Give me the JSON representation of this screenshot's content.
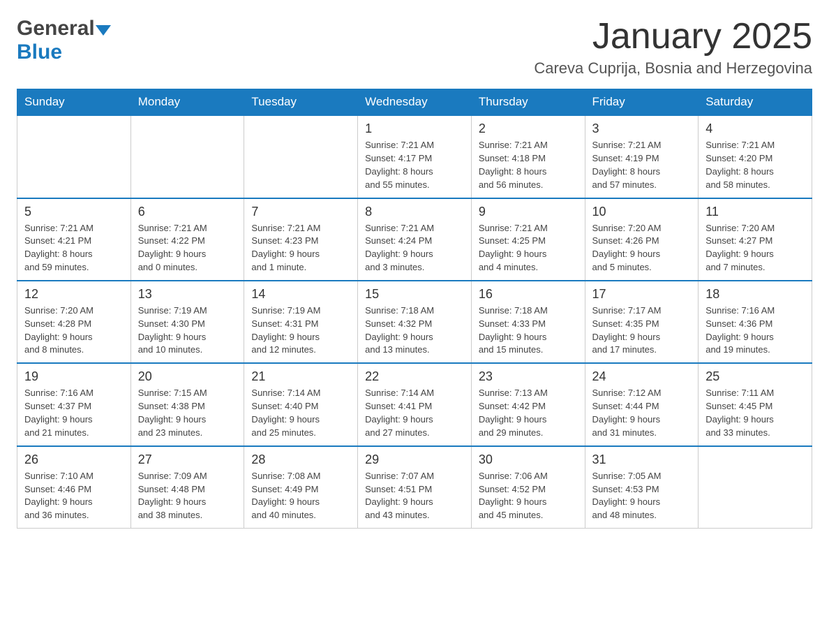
{
  "logo": {
    "general": "General",
    "blue": "Blue"
  },
  "header": {
    "month": "January 2025",
    "location": "Careva Cuprija, Bosnia and Herzegovina"
  },
  "days_of_week": [
    "Sunday",
    "Monday",
    "Tuesday",
    "Wednesday",
    "Thursday",
    "Friday",
    "Saturday"
  ],
  "weeks": [
    [
      {
        "day": "",
        "info": ""
      },
      {
        "day": "",
        "info": ""
      },
      {
        "day": "",
        "info": ""
      },
      {
        "day": "1",
        "info": "Sunrise: 7:21 AM\nSunset: 4:17 PM\nDaylight: 8 hours\nand 55 minutes."
      },
      {
        "day": "2",
        "info": "Sunrise: 7:21 AM\nSunset: 4:18 PM\nDaylight: 8 hours\nand 56 minutes."
      },
      {
        "day": "3",
        "info": "Sunrise: 7:21 AM\nSunset: 4:19 PM\nDaylight: 8 hours\nand 57 minutes."
      },
      {
        "day": "4",
        "info": "Sunrise: 7:21 AM\nSunset: 4:20 PM\nDaylight: 8 hours\nand 58 minutes."
      }
    ],
    [
      {
        "day": "5",
        "info": "Sunrise: 7:21 AM\nSunset: 4:21 PM\nDaylight: 8 hours\nand 59 minutes."
      },
      {
        "day": "6",
        "info": "Sunrise: 7:21 AM\nSunset: 4:22 PM\nDaylight: 9 hours\nand 0 minutes."
      },
      {
        "day": "7",
        "info": "Sunrise: 7:21 AM\nSunset: 4:23 PM\nDaylight: 9 hours\nand 1 minute."
      },
      {
        "day": "8",
        "info": "Sunrise: 7:21 AM\nSunset: 4:24 PM\nDaylight: 9 hours\nand 3 minutes."
      },
      {
        "day": "9",
        "info": "Sunrise: 7:21 AM\nSunset: 4:25 PM\nDaylight: 9 hours\nand 4 minutes."
      },
      {
        "day": "10",
        "info": "Sunrise: 7:20 AM\nSunset: 4:26 PM\nDaylight: 9 hours\nand 5 minutes."
      },
      {
        "day": "11",
        "info": "Sunrise: 7:20 AM\nSunset: 4:27 PM\nDaylight: 9 hours\nand 7 minutes."
      }
    ],
    [
      {
        "day": "12",
        "info": "Sunrise: 7:20 AM\nSunset: 4:28 PM\nDaylight: 9 hours\nand 8 minutes."
      },
      {
        "day": "13",
        "info": "Sunrise: 7:19 AM\nSunset: 4:30 PM\nDaylight: 9 hours\nand 10 minutes."
      },
      {
        "day": "14",
        "info": "Sunrise: 7:19 AM\nSunset: 4:31 PM\nDaylight: 9 hours\nand 12 minutes."
      },
      {
        "day": "15",
        "info": "Sunrise: 7:18 AM\nSunset: 4:32 PM\nDaylight: 9 hours\nand 13 minutes."
      },
      {
        "day": "16",
        "info": "Sunrise: 7:18 AM\nSunset: 4:33 PM\nDaylight: 9 hours\nand 15 minutes."
      },
      {
        "day": "17",
        "info": "Sunrise: 7:17 AM\nSunset: 4:35 PM\nDaylight: 9 hours\nand 17 minutes."
      },
      {
        "day": "18",
        "info": "Sunrise: 7:16 AM\nSunset: 4:36 PM\nDaylight: 9 hours\nand 19 minutes."
      }
    ],
    [
      {
        "day": "19",
        "info": "Sunrise: 7:16 AM\nSunset: 4:37 PM\nDaylight: 9 hours\nand 21 minutes."
      },
      {
        "day": "20",
        "info": "Sunrise: 7:15 AM\nSunset: 4:38 PM\nDaylight: 9 hours\nand 23 minutes."
      },
      {
        "day": "21",
        "info": "Sunrise: 7:14 AM\nSunset: 4:40 PM\nDaylight: 9 hours\nand 25 minutes."
      },
      {
        "day": "22",
        "info": "Sunrise: 7:14 AM\nSunset: 4:41 PM\nDaylight: 9 hours\nand 27 minutes."
      },
      {
        "day": "23",
        "info": "Sunrise: 7:13 AM\nSunset: 4:42 PM\nDaylight: 9 hours\nand 29 minutes."
      },
      {
        "day": "24",
        "info": "Sunrise: 7:12 AM\nSunset: 4:44 PM\nDaylight: 9 hours\nand 31 minutes."
      },
      {
        "day": "25",
        "info": "Sunrise: 7:11 AM\nSunset: 4:45 PM\nDaylight: 9 hours\nand 33 minutes."
      }
    ],
    [
      {
        "day": "26",
        "info": "Sunrise: 7:10 AM\nSunset: 4:46 PM\nDaylight: 9 hours\nand 36 minutes."
      },
      {
        "day": "27",
        "info": "Sunrise: 7:09 AM\nSunset: 4:48 PM\nDaylight: 9 hours\nand 38 minutes."
      },
      {
        "day": "28",
        "info": "Sunrise: 7:08 AM\nSunset: 4:49 PM\nDaylight: 9 hours\nand 40 minutes."
      },
      {
        "day": "29",
        "info": "Sunrise: 7:07 AM\nSunset: 4:51 PM\nDaylight: 9 hours\nand 43 minutes."
      },
      {
        "day": "30",
        "info": "Sunrise: 7:06 AM\nSunset: 4:52 PM\nDaylight: 9 hours\nand 45 minutes."
      },
      {
        "day": "31",
        "info": "Sunrise: 7:05 AM\nSunset: 4:53 PM\nDaylight: 9 hours\nand 48 minutes."
      },
      {
        "day": "",
        "info": ""
      }
    ]
  ]
}
